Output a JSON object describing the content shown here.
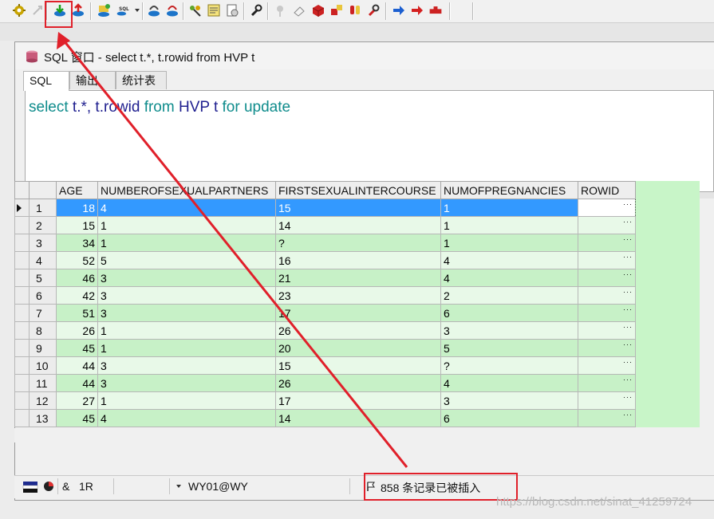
{
  "window": {
    "title": "SQL 窗口 - select t.*, t.rowid from HVP t",
    "tabs": [
      "SQL",
      "输出",
      "统计表"
    ]
  },
  "editor": {
    "sql": {
      "select": "select",
      "columns": "t.*, t.rowid",
      "from": "from",
      "table": "HVP t",
      "for_update": "for update"
    }
  },
  "grid": {
    "columns": [
      "AGE",
      "NUMBEROFSEXUALPARTNERS",
      "FIRSTSEXUALINTERCOURSE",
      "NUMOFPREGNANCIES",
      "ROWID"
    ],
    "rows": [
      {
        "n": "1",
        "age": "18",
        "partners": "4",
        "first": "15",
        "preg": "1"
      },
      {
        "n": "2",
        "age": "15",
        "partners": "1",
        "first": "14",
        "preg": "1"
      },
      {
        "n": "3",
        "age": "34",
        "partners": "1",
        "first": "?",
        "preg": "1"
      },
      {
        "n": "4",
        "age": "52",
        "partners": "5",
        "first": "16",
        "preg": "4"
      },
      {
        "n": "5",
        "age": "46",
        "partners": "3",
        "first": "21",
        "preg": "4"
      },
      {
        "n": "6",
        "age": "42",
        "partners": "3",
        "first": "23",
        "preg": "2"
      },
      {
        "n": "7",
        "age": "51",
        "partners": "3",
        "first": "17",
        "preg": "6"
      },
      {
        "n": "8",
        "age": "26",
        "partners": "1",
        "first": "26",
        "preg": "3"
      },
      {
        "n": "9",
        "age": "45",
        "partners": "1",
        "first": "20",
        "preg": "5"
      },
      {
        "n": "10",
        "age": "44",
        "partners": "3",
        "first": "15",
        "preg": "?"
      },
      {
        "n": "11",
        "age": "44",
        "partners": "3",
        "first": "26",
        "preg": "4"
      },
      {
        "n": "12",
        "age": "27",
        "partners": "1",
        "first": "17",
        "preg": "3"
      },
      {
        "n": "13",
        "age": "45",
        "partners": "4",
        "first": "14",
        "preg": "6"
      }
    ],
    "rowid_placeholder": "···"
  },
  "status": {
    "mode_symbol": "&",
    "row_count": "1R",
    "connection": "WY01@WY",
    "message": "858 条记录已被插入"
  },
  "watermark": "https://blog.csdn.net/sinat_41259724",
  "colors": {
    "accent_red": "#e0202a",
    "selected_row": "#3399ff",
    "grid_green_dark": "#c7f1c7",
    "grid_green_light": "#e8f9e8",
    "sql_keyword": "#0f8c8c",
    "sql_identifier": "#1f1f8f"
  },
  "icons": {
    "top_toolbar": [
      "gear-icon",
      "execute-disabled-icon",
      "import-tables-icon",
      "export-tables-icon",
      "database-icon",
      "sql-database-icon",
      "commit-icon",
      "rollback-icon",
      "keys-icon",
      "notes-icon",
      "report-icon",
      "wrench-icon",
      "pin-disabled-icon",
      "eraser-icon",
      "red-cube-icon",
      "cube-pair-icon",
      "hands-icon",
      "wrench-red-icon",
      "arrow-right-blue-icon",
      "arrow-right-red-icon",
      "stop-sign-icon"
    ],
    "grid_toolbar": [
      "grid-select-icon",
      "lock-icon",
      "plus-icon",
      "minus-icon",
      "check-icon",
      "post-down-icon",
      "post-down-all-icon",
      "clear-icon",
      "eraser-icon",
      "query-by-example-icon",
      "filter-down-icon",
      "filter-up-icon",
      "tree-icon",
      "save-icon",
      "export-data-icon",
      "chart-icon"
    ]
  }
}
